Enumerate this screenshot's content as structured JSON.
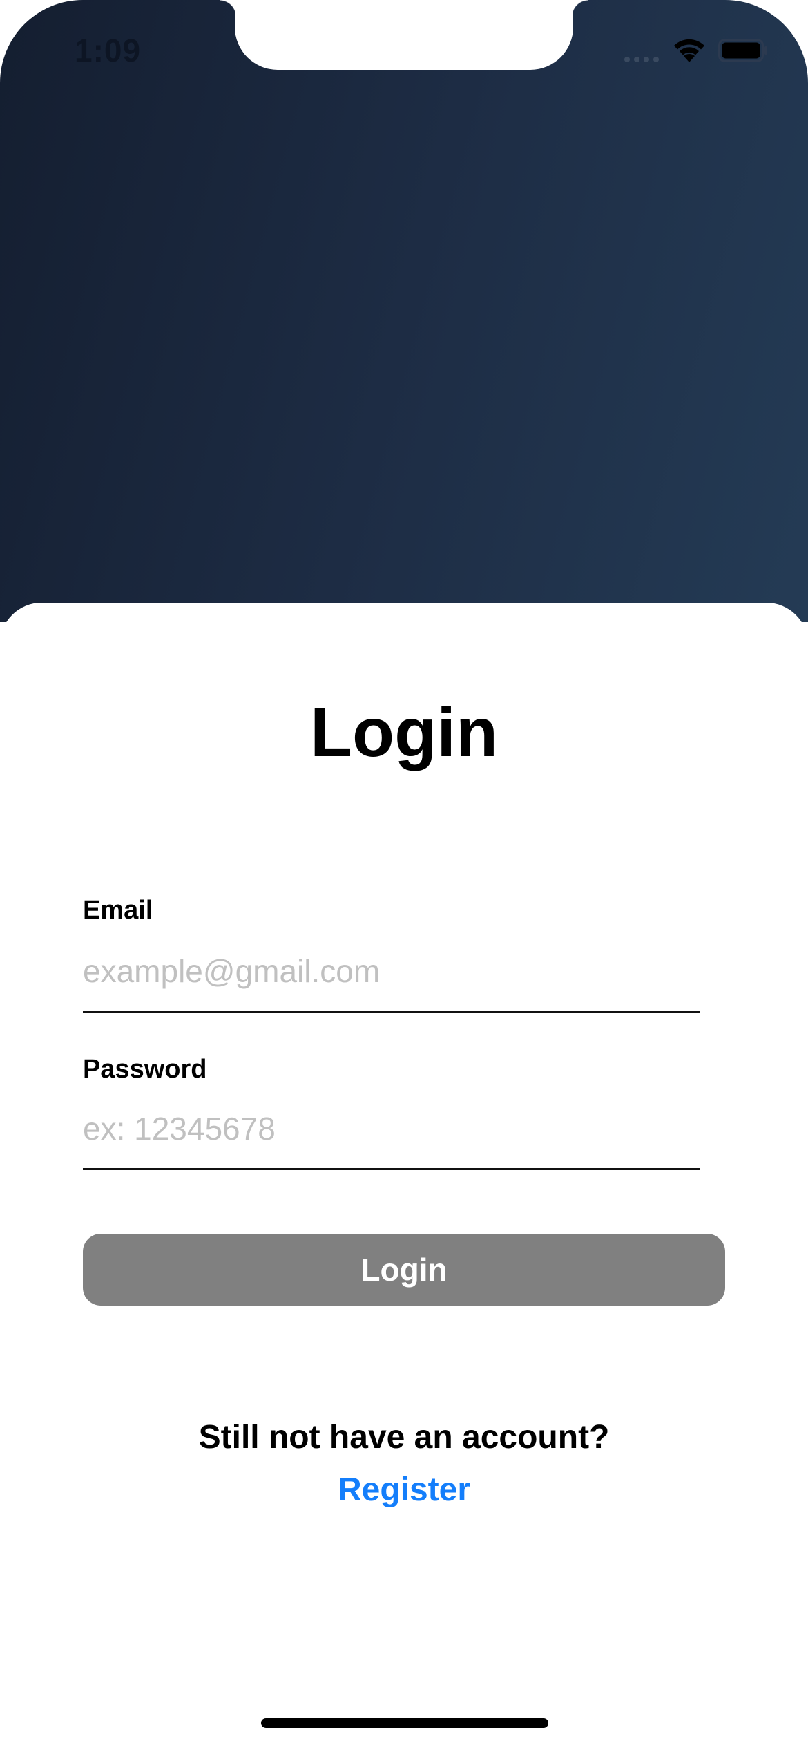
{
  "status_bar": {
    "time": "1:09"
  },
  "colors": {
    "hero_gradient_start": "#141e30",
    "hero_gradient_end": "#243b55",
    "button_bg": "#808080",
    "link": "#147efb",
    "placeholder": "#c0c0c0"
  },
  "login": {
    "title": "Login",
    "email_label": "Email",
    "email_placeholder": "example@gmail.com",
    "email_value": "",
    "password_label": "Password",
    "password_placeholder": "ex: 12345678",
    "password_value": "",
    "button_label": "Login",
    "account_prompt": "Still not have an account?",
    "register_label": "Register"
  },
  "icons": {
    "wifi": "wifi-icon",
    "battery": "battery-icon",
    "cellular": "cellular-signal-icon"
  }
}
